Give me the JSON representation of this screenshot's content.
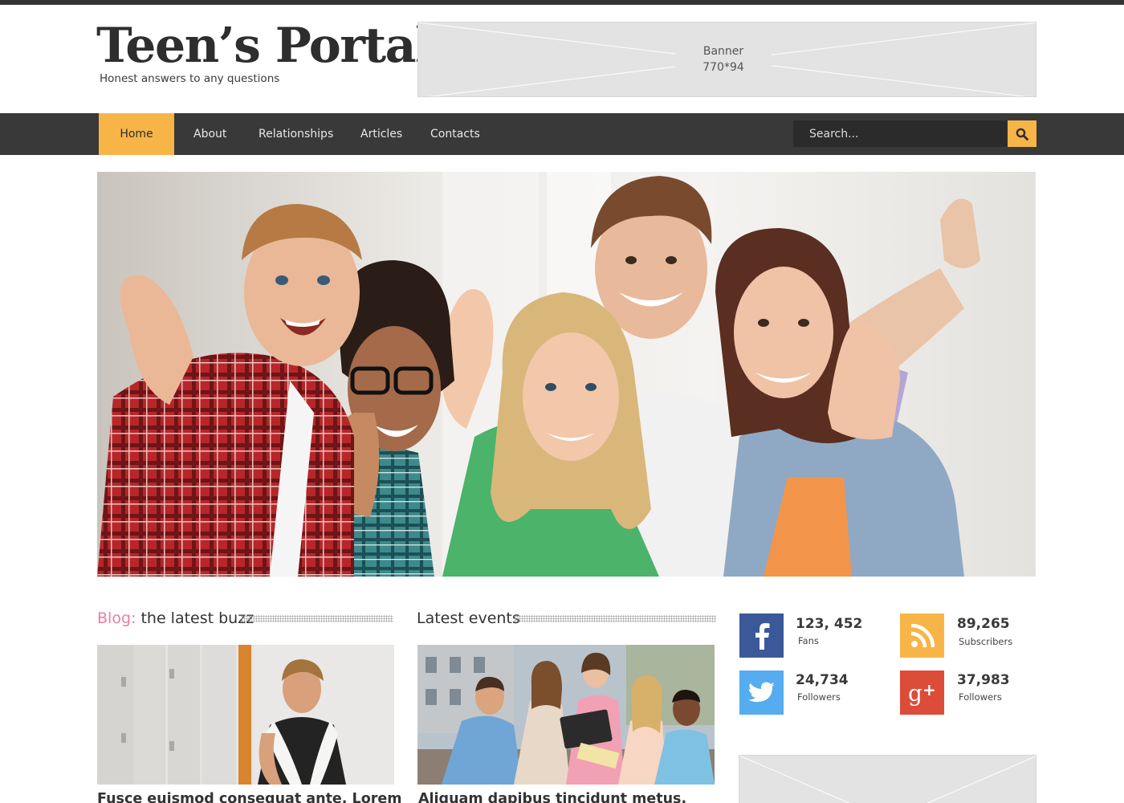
{
  "header": {
    "logo": "Teen’s Portal",
    "tagline": "Honest answers to any questions",
    "banner_line1": "Banner",
    "banner_line2": "770*94"
  },
  "nav": {
    "items": [
      {
        "label": "Home",
        "active": true
      },
      {
        "label": "About"
      },
      {
        "label": "Relationships"
      },
      {
        "label": "Articles"
      },
      {
        "label": "Contacts"
      }
    ],
    "search_placeholder": "Search...",
    "search_icon": "search-icon"
  },
  "hero": {
    "image": "group-of-teens-thumbs-up"
  },
  "blog": {
    "title_accent": "Blog:",
    "title_rest": " the latest buzz",
    "post_title": "Fusce euismod consequat ante. Lorem"
  },
  "events": {
    "title": "Latest events",
    "post_title": "Aliquam dapibus tincidunt metus."
  },
  "social": [
    {
      "network": "facebook",
      "icon": "facebook-icon",
      "count": "123, 452",
      "label": "Fans",
      "color": "#3b5998"
    },
    {
      "network": "rss",
      "icon": "rss-icon",
      "count": "89,265",
      "label": "Subscribers",
      "color": "#f7b548"
    },
    {
      "network": "twitter",
      "icon": "twitter-icon",
      "count": "24,734",
      "label": "Followers",
      "color": "#55acee"
    },
    {
      "network": "google-plus",
      "icon": "google-plus-icon",
      "count": "37,983",
      "label": "Followers",
      "color": "#dd4b39"
    }
  ],
  "colors": {
    "accent": "#f7b548",
    "pink": "#e97fa4",
    "nav_bg": "#393939"
  }
}
